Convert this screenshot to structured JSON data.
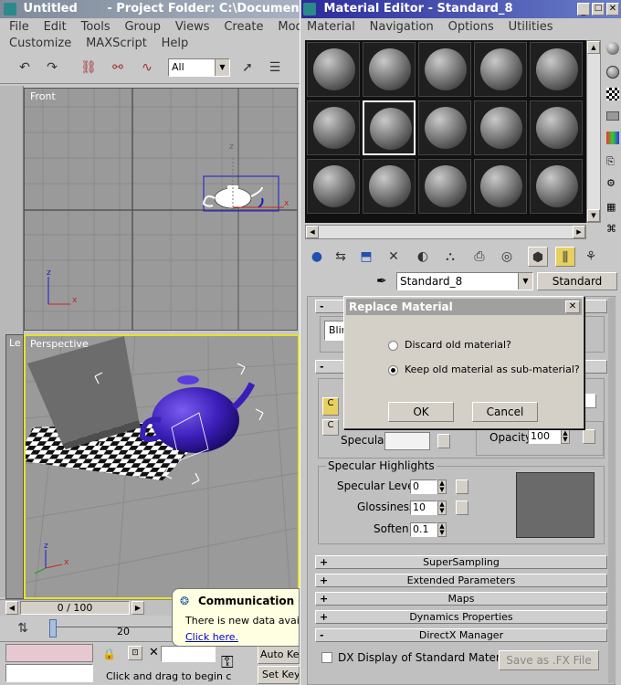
{
  "main_window": {
    "title": "Untitled",
    "project": "- Project Folder: C:\\Documents",
    "menu_row1": [
      "File",
      "Edit",
      "Tools",
      "Group",
      "Views",
      "Create",
      "Modifiers"
    ],
    "menu_row2": [
      "Customize",
      "MAXScript",
      "Help"
    ],
    "selection_filter": "All"
  },
  "viewports": {
    "front_label": "Front",
    "perspective_label": "Perspective",
    "left_label": "Le"
  },
  "timeline": {
    "frame_counter": "0 / 100",
    "tick_label": "20"
  },
  "status": {
    "hint": "Click and drag to begin c",
    "auto_key": "Auto Key",
    "set_key": "Set Key"
  },
  "notification": {
    "title": "Communication Ce",
    "body": "There is new data availab",
    "link": "Click here."
  },
  "material_editor": {
    "title": "Material Editor - Standard_8",
    "menu": [
      "Material",
      "Navigation",
      "Options",
      "Utilities"
    ],
    "material_name": "Standard_8",
    "material_type": "Standard",
    "shader_stub": "Blin",
    "opacity_label": "Opacity:",
    "opacity_value": "100",
    "specular_label": "Specular:",
    "specular_highlights_title": "Specular Highlights",
    "specular_level_label": "Specular Level:",
    "specular_level_value": "0",
    "glossiness_label": "Glossiness:",
    "glossiness_value": "10",
    "soften_label": "Soften:",
    "soften_value": "0.1",
    "rollouts": [
      {
        "sign": "+",
        "label": "SuperSampling"
      },
      {
        "sign": "+",
        "label": "Extended Parameters"
      },
      {
        "sign": "+",
        "label": "Maps"
      },
      {
        "sign": "+",
        "label": "Dynamics Properties"
      },
      {
        "sign": "-",
        "label": "DirectX Manager"
      }
    ],
    "dx_checkbox_label": "DX Display of Standard Material",
    "save_fx_label": "Save as .FX File"
  },
  "dialog": {
    "title": "Replace Material",
    "option1": "Discard old material?",
    "option2": "Keep old material as sub-material?",
    "selected_option": 2,
    "ok_label": "OK",
    "cancel_label": "Cancel"
  }
}
